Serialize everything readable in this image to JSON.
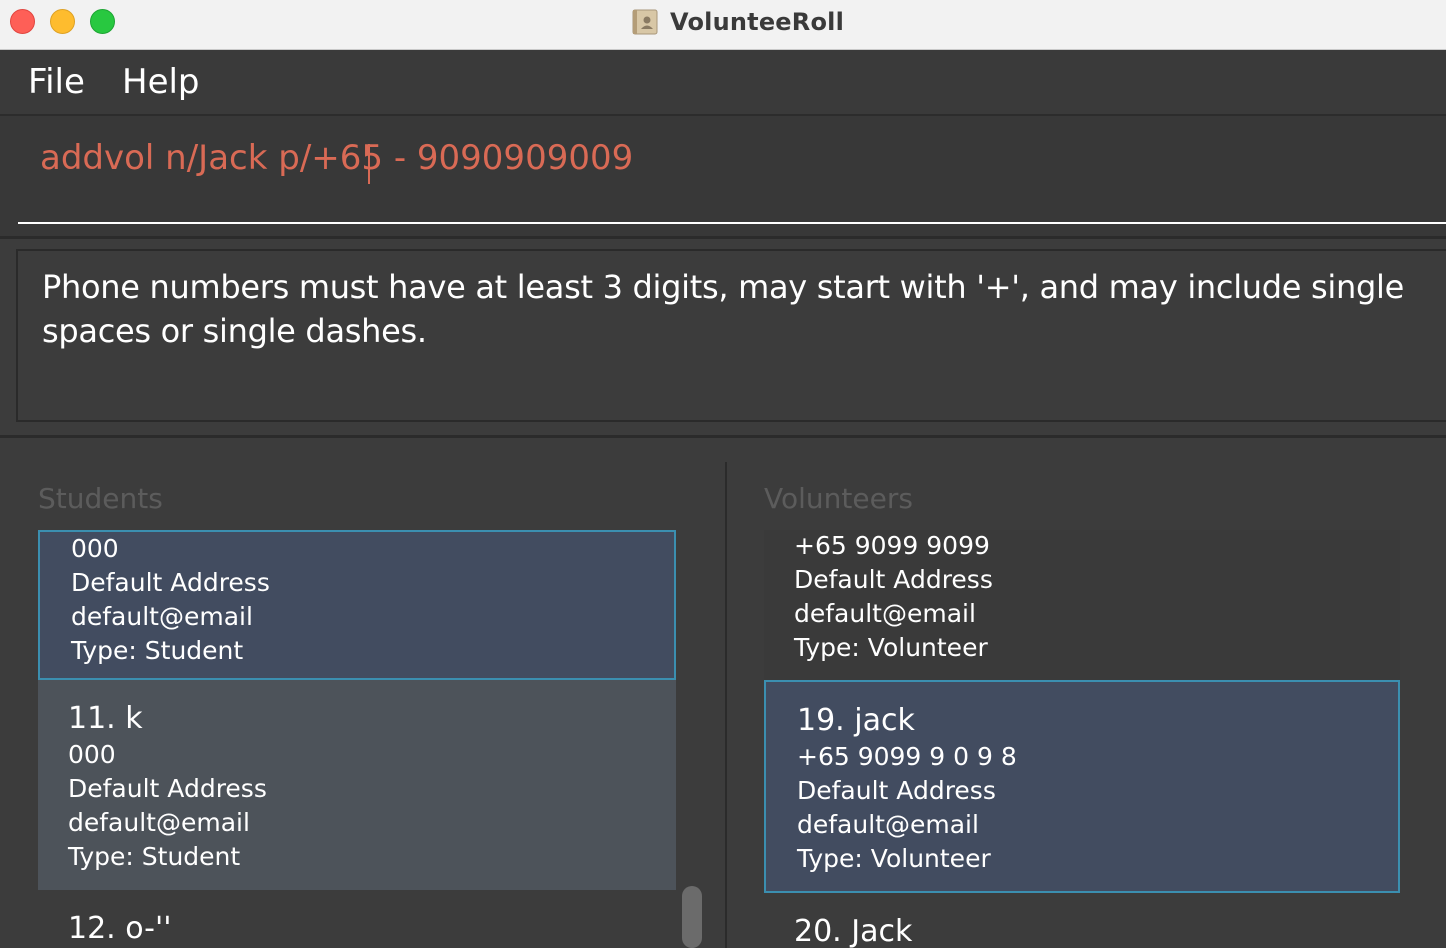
{
  "window": {
    "title": "VolunteeRoll"
  },
  "menu": {
    "file": "File",
    "help": "Help"
  },
  "command": {
    "text": "addvol n/Jack p/+65 - 9090909009"
  },
  "result": {
    "message": "Phone numbers must have at least 3 digits, may start with '+', and may include single spaces or single dashes."
  },
  "students": {
    "label": "Students",
    "cards": [
      {
        "phone": "000",
        "address": "Default Address",
        "email": "default@email",
        "type": "Type: Student"
      },
      {
        "name": "11. k",
        "phone": "000",
        "address": "Default Address",
        "email": "default@email",
        "type": "Type: Student"
      },
      {
        "name": "12. o-''"
      }
    ]
  },
  "volunteers": {
    "label": "Volunteers",
    "cards": [
      {
        "phone": "+65 9099 9099",
        "address": "Default Address",
        "email": "default@email",
        "type": "Type: Volunteer"
      },
      {
        "name": "19. jack",
        "phone": "+65 9099 9 0 9 8",
        "address": "Default Address",
        "email": "default@email",
        "type": "Type: Volunteer"
      },
      {
        "name": "20. Jack"
      }
    ]
  },
  "colors": {
    "command_text": "#d96a55",
    "selected_card": "#424c60",
    "selected_border": "#3b8fb0"
  },
  "icons": [
    "close-window-icon",
    "minimize-window-icon",
    "maximize-window-icon",
    "app-contacts-icon"
  ]
}
